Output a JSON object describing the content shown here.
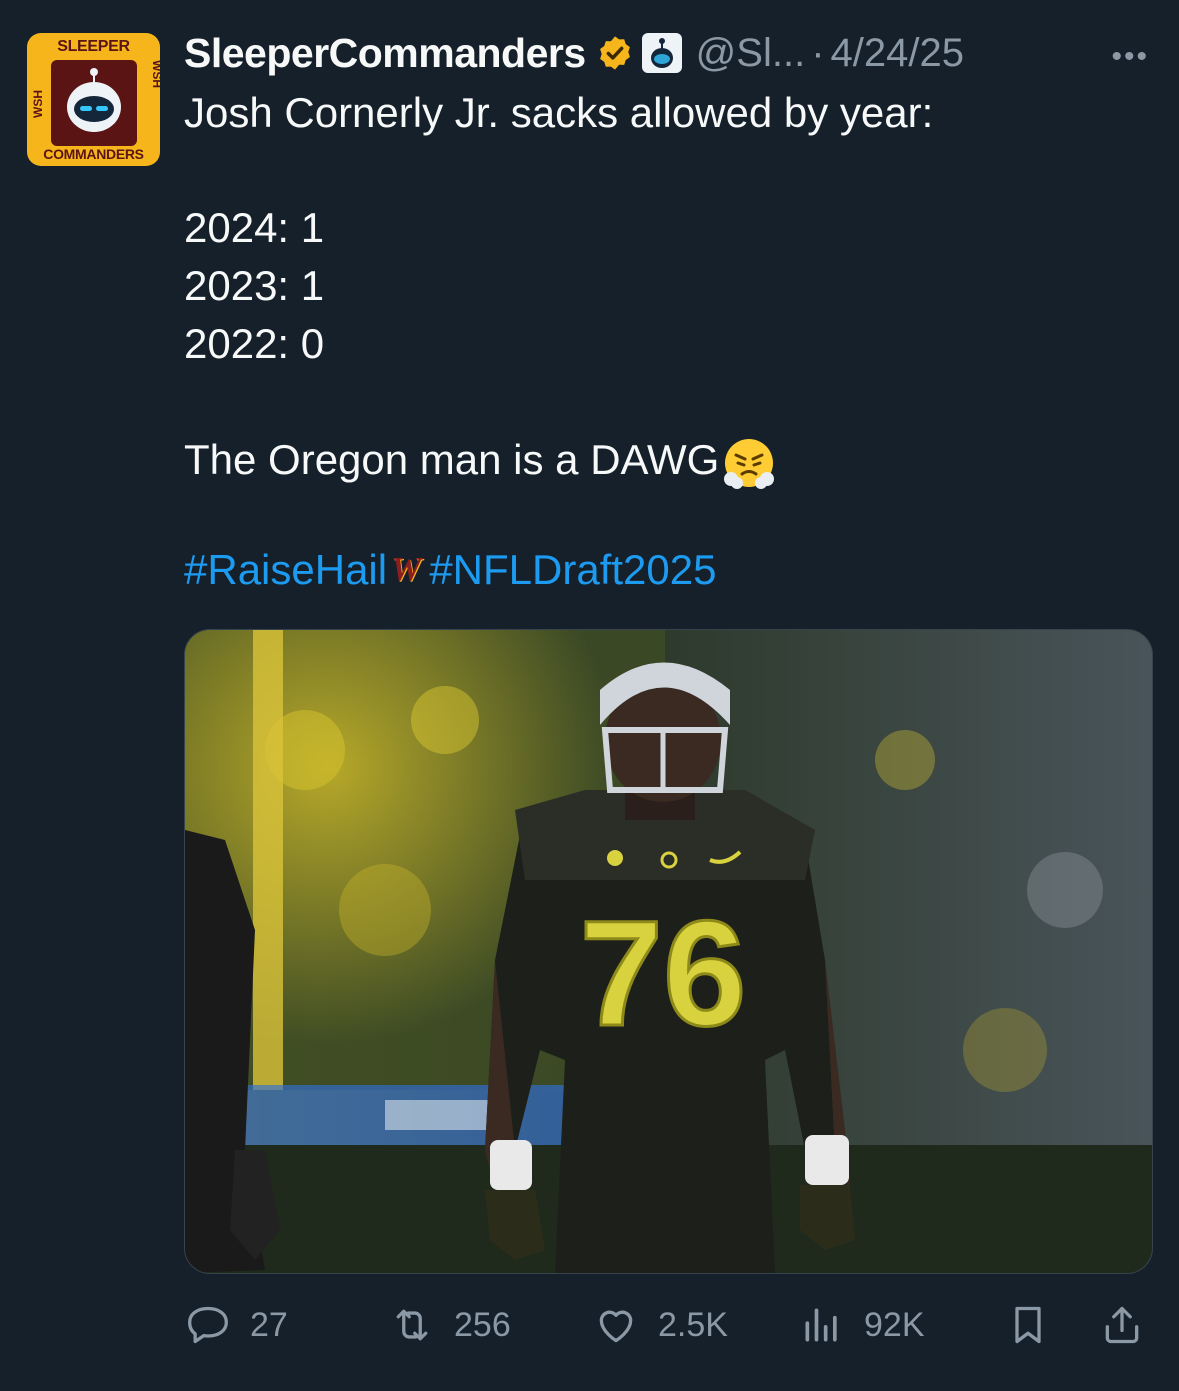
{
  "tweet": {
    "author": {
      "display_name": "SleeperCommanders",
      "handle": "@Sl...",
      "avatar_top": "SLEEPER",
      "avatar_bottom": "COMMANDERS",
      "avatar_side": "WSH"
    },
    "separator": "·",
    "date": "4/24/25",
    "more_icon": "•••",
    "lines": {
      "intro": "Josh Cornerly Jr. sacks allowed by year:",
      "y2024": "2024: 1",
      "y2023": "2023: 1",
      "y2022": "2022: 0",
      "closing": "The Oregon man is a DAWG"
    },
    "hashtags": {
      "first": "#RaiseHail",
      "logo": "W",
      "second": "#NFLDraft2025"
    },
    "photo": {
      "jersey_number": "76"
    },
    "actions": {
      "replies": "27",
      "reposts": "256",
      "likes": "2.5K",
      "views": "92K"
    }
  },
  "colors": {
    "background": "#15202b",
    "text": "#f7f9f9",
    "muted": "#8b98a5",
    "link": "#1d9bf0",
    "verified": "#f7b51c"
  },
  "icons": [
    "verified-badge-icon",
    "sleeper-affiliate-icon",
    "more-icon",
    "steam-emoji-icon",
    "reply-icon",
    "repost-icon",
    "like-icon",
    "views-icon",
    "bookmark-icon",
    "share-icon"
  ]
}
